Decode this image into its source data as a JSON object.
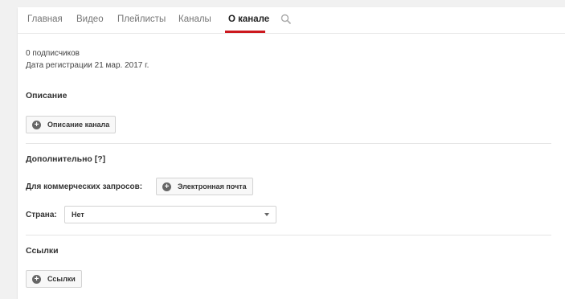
{
  "tabs": {
    "items": [
      {
        "label": "Главная"
      },
      {
        "label": "Видео"
      },
      {
        "label": "Плейлисты"
      },
      {
        "label": "Каналы"
      },
      {
        "label": "О канале"
      }
    ],
    "search_icon": "search-icon",
    "active_color": "#cc181e"
  },
  "about": {
    "subscribers": "0 подписчиков",
    "registered": "Дата регистрации 21 мар. 2017 г."
  },
  "description": {
    "title": "Описание",
    "button_label": "Описание канала"
  },
  "additional": {
    "title": "Дополнительно [?]",
    "business_label": "Для коммерческих запросов:",
    "email_button_label": "Электронная почта",
    "country_label": "Страна:",
    "country_value": "Нет"
  },
  "links": {
    "title": "Ссылки",
    "button_label": "Ссылки"
  },
  "icons": {
    "plus": "+"
  }
}
